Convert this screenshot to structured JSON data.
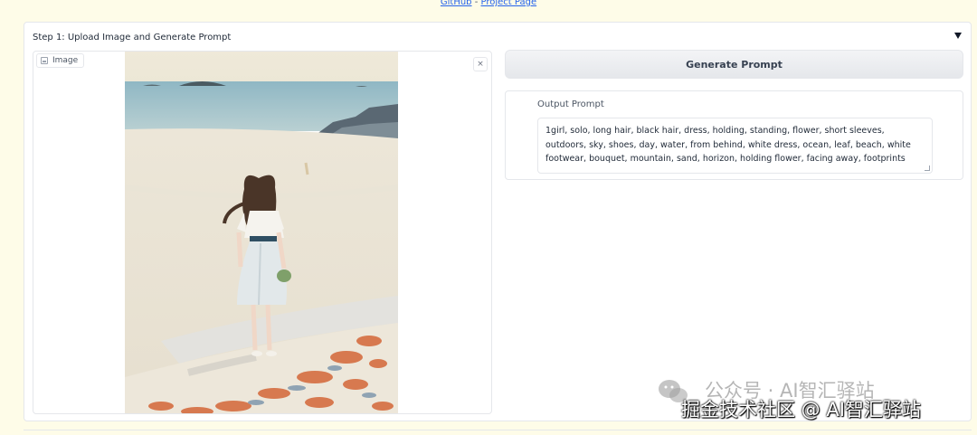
{
  "header_links": {
    "github": "GitHub",
    "separator": " - ",
    "project_page": "Project Page"
  },
  "step": {
    "title": "Step 1: Upload Image and Generate Prompt",
    "collapse_icon": "triangle-down-icon"
  },
  "image_input": {
    "label": "Image",
    "clear_icon": "close-icon",
    "clear_glyph": "×"
  },
  "generate_button": {
    "label": "Generate Prompt"
  },
  "output": {
    "label": "Output Prompt",
    "value": "1girl, solo, long hair, black hair, dress, holding, standing, flower, short sleeves, outdoors, sky, shoes, day, water, from behind, white dress, ocean, leaf, beach, white footwear, bouquet, mountain, sand, horizon, holding flower, facing away, footprints"
  },
  "watermark": {
    "line1": "公众号 · AI智汇驿站",
    "line2": "掘金技术社区 @ AI智汇驿站"
  },
  "colors": {
    "page_background": "#fefce8",
    "link": "#2563eb",
    "button_background": "#e5e7eb"
  }
}
